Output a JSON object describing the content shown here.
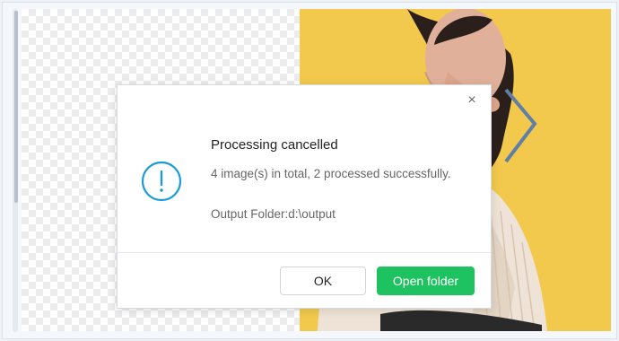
{
  "dialog": {
    "title": "Processing cancelled",
    "message": "4 image(s) in total, 2 processed successfully.",
    "output_folder": "Output Folder:d:\\output",
    "ok_label": "OK",
    "open_folder_label": "Open folder",
    "close_icon": "×",
    "icon": "exclamation-circle-icon"
  },
  "colors": {
    "accent_green": "#1ec261",
    "info_blue": "#1a9bd7",
    "photo_background": "#f2c94d"
  }
}
